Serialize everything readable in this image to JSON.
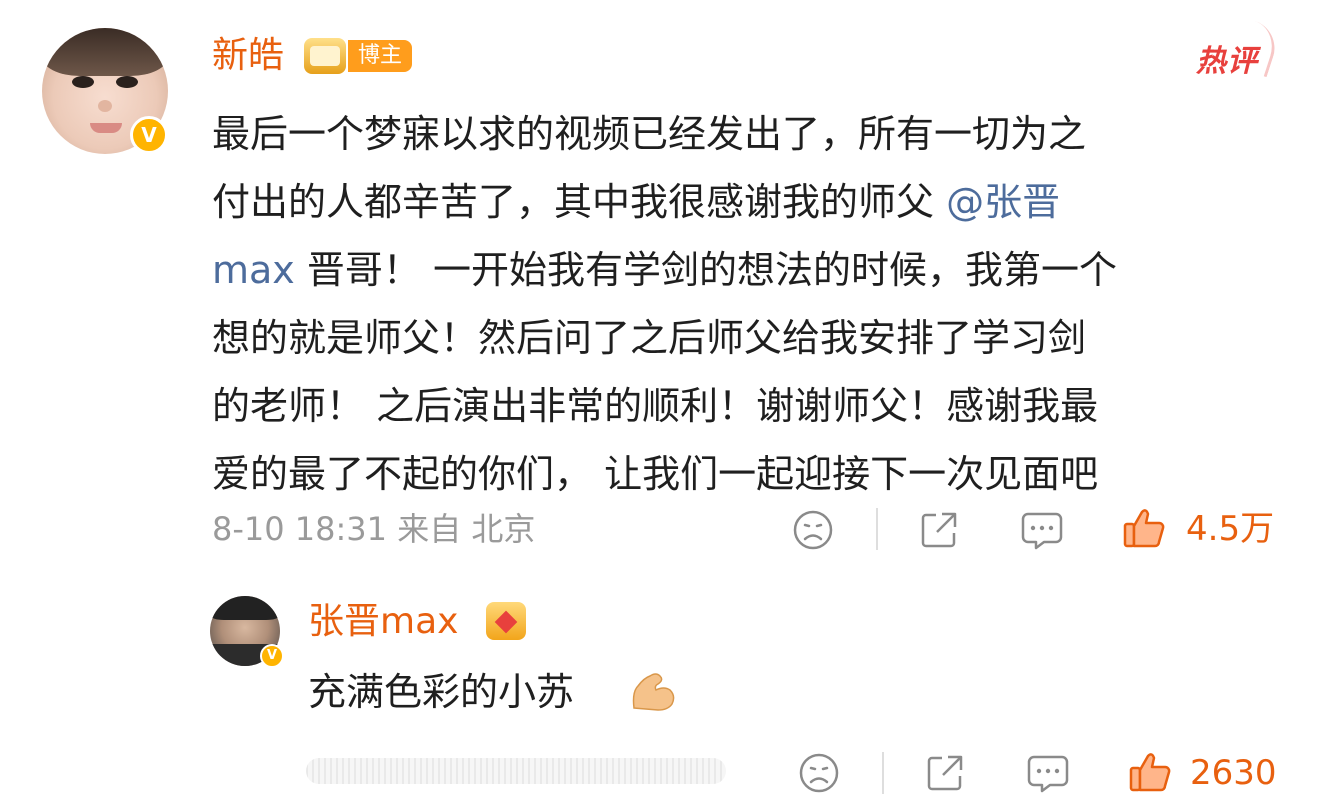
{
  "comment": {
    "username": "新皓",
    "badge": "博主",
    "hot_label": "热评",
    "content_lines": [
      "最后一个梦寐以求的视频已经发出了，所有一切为之",
      "付出的人都辛苦了，其中我很感谢我的师父",
      "晋哥！ 一开始我有学剑的想法的时候，我第一个",
      "想的就是师父！然后问了之后师父给我安排了学习剑",
      "的老师！ 之后演出非常的顺利！谢谢师父！感谢我最",
      "爱的最了不起的你们， 让我们一起迎接下一次见面吧"
    ],
    "mention_part1": "@张晋",
    "mention_part2": "max",
    "timestamp": "8-10 18:31",
    "source": "来自 北京",
    "like_count": "4.5万",
    "verified": "V"
  },
  "reply": {
    "username": "张晋max",
    "text": "充满色彩的小苏",
    "like_count": "2630",
    "verified": "V"
  },
  "colors": {
    "username": "#e8600f",
    "mention": "#4d6c9c",
    "meta": "#9a9a9a",
    "hot": "#e8403d"
  }
}
